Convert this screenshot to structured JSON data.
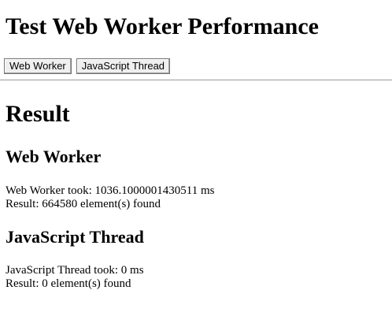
{
  "page": {
    "title": "Test Web Worker Performance"
  },
  "toolbar": {
    "web_worker_label": "Web Worker",
    "js_thread_label": "JavaScript Thread"
  },
  "result": {
    "heading": "Result",
    "web_worker": {
      "heading": "Web Worker",
      "timing_text": "Web Worker took: 1036.1000001430511 ms",
      "result_text": "Result: 664580 element(s) found"
    },
    "js_thread": {
      "heading": "JavaScript Thread",
      "timing_text": "JavaScript Thread took: 0 ms",
      "result_text": "Result: 0 element(s) found"
    }
  }
}
